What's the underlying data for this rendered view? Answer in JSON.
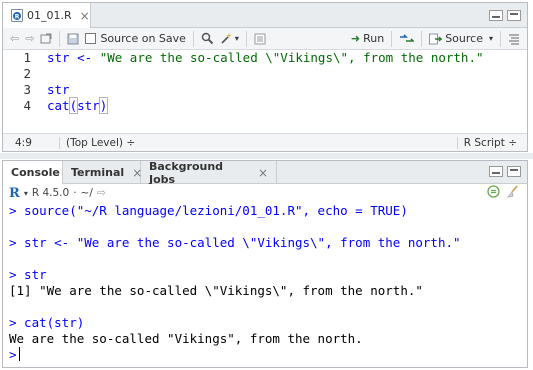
{
  "editor": {
    "tab": {
      "filename": "01_01.R",
      "close": "×"
    },
    "toolbar": {
      "source_on_save": "Source on Save",
      "run": "Run",
      "source": "Source"
    },
    "lines": [
      {
        "n": "1",
        "op": "str <- ",
        "str": "\"We are the so-called \\\"Vikings\\\", from the north.\""
      },
      {
        "n": "2",
        "op": "",
        "str": ""
      },
      {
        "n": "3",
        "op": "str",
        "str": ""
      },
      {
        "n": "4",
        "op": "cat",
        "paren_open": "(",
        "arg": "str",
        "paren_close": ")"
      }
    ],
    "status": {
      "position": "4:9",
      "scope": "(Top Level)",
      "scope_arrow": "÷",
      "filetype": "R Script",
      "filetype_arrow": "÷"
    }
  },
  "console": {
    "tabs": [
      {
        "label": "Console"
      },
      {
        "label": "Terminal",
        "close": "×"
      },
      {
        "label": "Background Jobs",
        "close": "×"
      }
    ],
    "subbar": {
      "r_letter": "R",
      "version": "R 4.5.0",
      "sep": "·",
      "path": "~/"
    },
    "lines": [
      {
        "text": "> source(\"~/R language/lezioni/01_01.R\", echo = TRUE)",
        "kind": "cmd"
      },
      {
        "text": "> str <- \"We are the so-called \\\"Vikings\\\", from the north.\"",
        "kind": "cmd"
      },
      {
        "text": "> str",
        "kind": "cmd"
      },
      {
        "text": "[1] \"We are the so-called \\\"Vikings\\\", from the north.\"",
        "kind": "out"
      },
      {
        "text": "> cat(str)",
        "kind": "cmd"
      },
      {
        "text": "We are the so-called \"Vikings\", from the north.",
        "kind": "out"
      },
      {
        "text": ">",
        "kind": "cmd"
      }
    ]
  },
  "colors": {
    "command": "#0000ff",
    "string": "#036a07",
    "output": "#000000",
    "r_blue": "#1f65b7"
  }
}
